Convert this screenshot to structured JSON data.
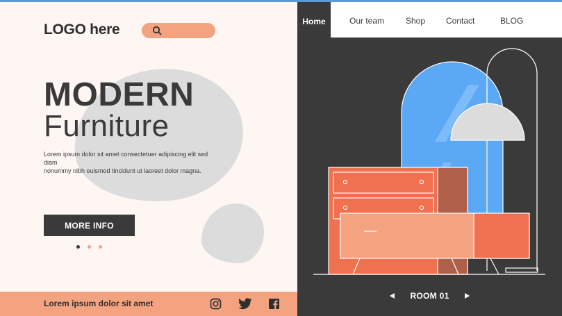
{
  "header": {
    "logo": "LOGO here"
  },
  "search": {
    "icon": "search-icon"
  },
  "hero": {
    "title_line1": "MODERN",
    "title_line2": "Furniture",
    "body_line1": "Lorem ipsum dolor sit amet consectetuer adipiscing elit sed diam",
    "body_line2": "nonummy nibh euismod tincidunt ut laoreet dolor magna.",
    "cta_label": "MORE INFO"
  },
  "carousel": {
    "dots": [
      "#3a3a3a",
      "#f4a381",
      "#f4a381"
    ]
  },
  "footer": {
    "text": "Lorem ipsum dolor sit amet",
    "social_icons": [
      "instagram-icon",
      "twitter-icon",
      "facebook-icon"
    ]
  },
  "nav": {
    "items": [
      {
        "label": "Home",
        "active": true
      },
      {
        "label": "Our team"
      },
      {
        "label": "Shop"
      },
      {
        "label": "Contact"
      },
      {
        "label": "BLOG"
      }
    ]
  },
  "room": {
    "label": "ROOM 01",
    "prev_icon": "triangle-left-icon",
    "next_icon": "triangle-right-icon"
  },
  "colors": {
    "dark": "#3a3a3a",
    "accent": "#f4a381",
    "cream": "#fdf6f3",
    "coral": "#ef7150",
    "mirror": "#5ba8f5",
    "grey": "#dcdcdc"
  }
}
